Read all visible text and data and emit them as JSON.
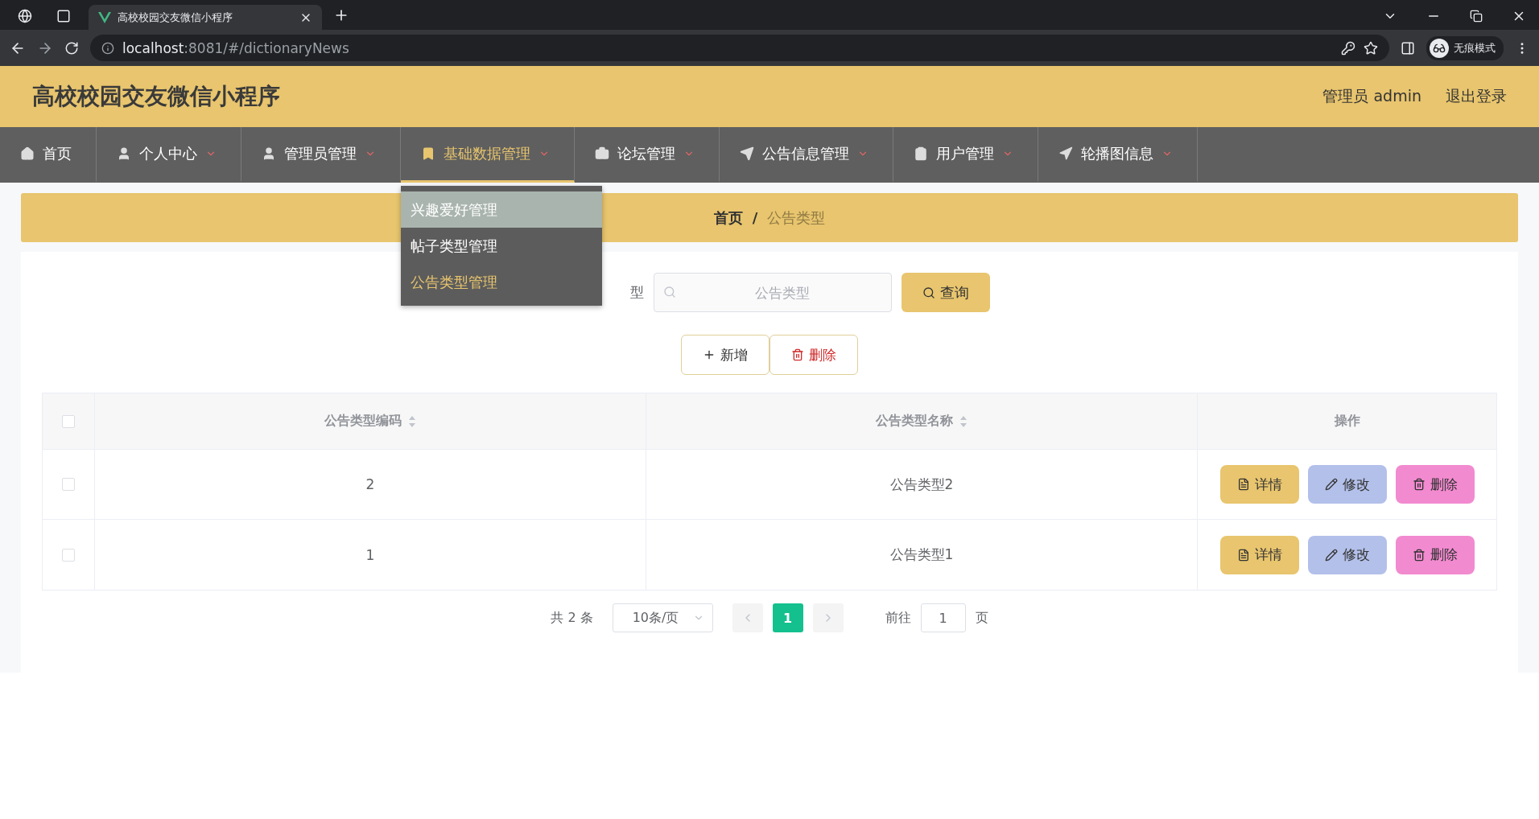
{
  "browser": {
    "tab_title": "高校校园交友微信小程序",
    "url_host": "localhost",
    "url_rest": ":8081/#/dictionaryNews",
    "incognito": "无痕模式"
  },
  "header": {
    "title": "高校校园交友微信小程序",
    "user": "管理员 admin",
    "logout": "退出登录"
  },
  "nav": [
    {
      "label": "首页",
      "selected": false,
      "caret": false
    },
    {
      "label": "个人中心",
      "selected": false,
      "caret": true
    },
    {
      "label": "管理员管理",
      "selected": false,
      "caret": true
    },
    {
      "label": "基础数据管理",
      "selected": true,
      "caret": true
    },
    {
      "label": "论坛管理",
      "selected": false,
      "caret": true
    },
    {
      "label": "公告信息管理",
      "selected": false,
      "caret": true
    },
    {
      "label": "用户管理",
      "selected": false,
      "caret": true
    },
    {
      "label": "轮播图信息",
      "selected": false,
      "caret": true
    }
  ],
  "dropdown": [
    {
      "label": "兴趣爱好管理",
      "hovered": true,
      "selected": false
    },
    {
      "label": "帖子类型管理",
      "hovered": false,
      "selected": false
    },
    {
      "label": "公告类型管理",
      "hovered": false,
      "selected": true
    }
  ],
  "breadcrumb": [
    "首页",
    "公告类型"
  ],
  "breadcrumb_separator": "/",
  "search": {
    "label": "型",
    "placeholder": "公告类型",
    "button": "查询"
  },
  "actions": [
    {
      "label": "新增",
      "kind": "add"
    },
    {
      "label": "删除",
      "kind": "delete"
    }
  ],
  "table": {
    "select_all": false,
    "columns": [
      {
        "label": "公告类型编码",
        "sortable": true
      },
      {
        "label": "公告类型名称",
        "sortable": true
      },
      {
        "label": "操作",
        "sortable": false
      }
    ],
    "rows": [
      {
        "checked": false,
        "cells": [
          "2",
          "公告类型2"
        ],
        "buttons": [
          {
            "label": "详情",
            "kind": "detail"
          },
          {
            "label": "修改",
            "kind": "edit"
          },
          {
            "label": "删除",
            "kind": "delete"
          }
        ]
      },
      {
        "checked": false,
        "cells": [
          "1",
          "公告类型1"
        ],
        "buttons": [
          {
            "label": "详情",
            "kind": "detail"
          },
          {
            "label": "修改",
            "kind": "edit"
          },
          {
            "label": "删除",
            "kind": "delete"
          }
        ]
      }
    ]
  },
  "pagination": {
    "total": "共 2 条",
    "page_size": "10条/页",
    "pages": [
      {
        "label": "1",
        "selected": true
      }
    ],
    "goto_label": "前往",
    "goto_value": "1",
    "page_suffix": "页"
  }
}
